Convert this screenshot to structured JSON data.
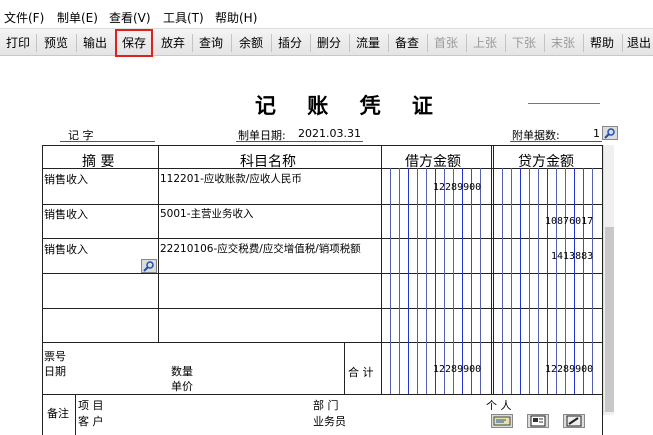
{
  "menu": [
    "文件(F)",
    "制单(E)",
    "查看(V)",
    "工具(T)",
    "帮助(H)"
  ],
  "toolbar": [
    "打印",
    "预览",
    "输出",
    "保存",
    "放弃",
    "查询",
    "余额",
    "插分",
    "删分",
    "流量",
    "备查",
    "首张",
    "上张",
    "下张",
    "末张",
    "帮助",
    "退出"
  ],
  "toolbar_disabled": [
    "首张",
    "上张",
    "下张",
    "末张"
  ],
  "toolbar_highlighted": "保存",
  "voucher": {
    "title": "记 账 凭 证",
    "type_label": "记 字",
    "date_label": "制单日期:",
    "date": "2021.03.31",
    "attachments_label": "附单据数:",
    "attachments": "1"
  },
  "table": {
    "headers": [
      "摘 要",
      "科目名称",
      "借方金额",
      "贷方金额"
    ],
    "rows": [
      {
        "summary": "销售收入",
        "account": "112201-应收账款/应收人民币",
        "debit": "12289900",
        "credit": ""
      },
      {
        "summary": "销售收入",
        "account": "5001-主营业务收入",
        "debit": "",
        "credit": "10876017"
      },
      {
        "summary": "销售收入",
        "account": "22210106-应交税费/应交增值税/销项税额",
        "debit": "",
        "credit": "1413883"
      },
      {
        "summary": "",
        "account": "",
        "debit": "",
        "credit": ""
      },
      {
        "summary": "",
        "account": "",
        "debit": "",
        "credit": ""
      }
    ],
    "footer": {
      "bill_no_label": "票号",
      "date_label": "日期",
      "quantity_label": "数量",
      "price_label": "单价",
      "total_label": "合 计",
      "debit_total": "12289900",
      "credit_total": "12289900"
    },
    "remarks": {
      "label": "备注",
      "project_label": "项 目",
      "customer_label": "客 户",
      "dept_label": "部 门",
      "salesperson_label": "业务员",
      "person_label": "个 人"
    }
  },
  "colors": {
    "highlight": "#e0201b",
    "amount_blue": "#2233cc",
    "amount_red": "#cc2222"
  }
}
